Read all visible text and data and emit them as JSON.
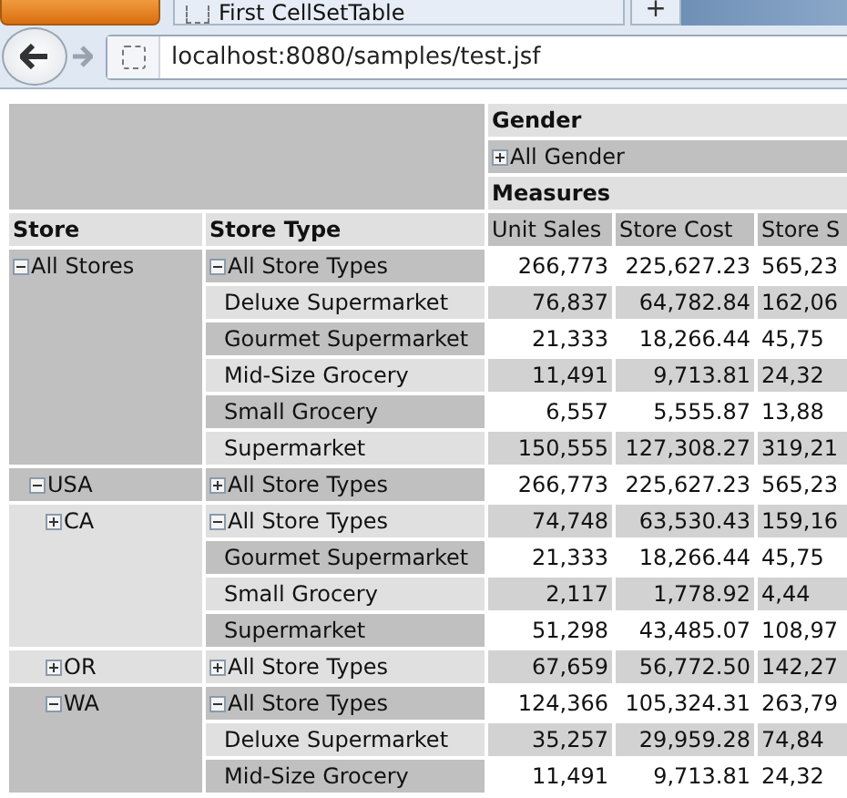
{
  "browser": {
    "tab_title": "First CellSetTable",
    "new_tab": "+",
    "url": "localhost:8080/samples/test.jsf"
  },
  "pivot": {
    "column_hierarchy": "Gender",
    "column_member": {
      "name": "All Gender",
      "expanded": false
    },
    "measures_label": "Measures",
    "row_headers": [
      "Store",
      "Store Type"
    ],
    "measures": [
      "Unit Sales",
      "Store Cost",
      "Store S"
    ],
    "stores": [
      {
        "name": "All Stores",
        "expanded": true,
        "types": [
          {
            "kind": "all",
            "name": "All Store Types",
            "expanded": true,
            "values": [
              "266,773",
              "225,627.23",
              "565,23"
            ]
          },
          {
            "kind": "leaf",
            "name": "Deluxe Supermarket",
            "values": [
              "76,837",
              "64,782.84",
              "162,06"
            ]
          },
          {
            "kind": "leaf",
            "name": "Gourmet Supermarket",
            "values": [
              "21,333",
              "18,266.44",
              "45,75"
            ]
          },
          {
            "kind": "leaf",
            "name": "Mid-Size Grocery",
            "values": [
              "11,491",
              "9,713.81",
              "24,32"
            ]
          },
          {
            "kind": "leaf",
            "name": "Small Grocery",
            "values": [
              "6,557",
              "5,555.87",
              "13,88"
            ]
          },
          {
            "kind": "leaf",
            "name": "Supermarket",
            "values": [
              "150,555",
              "127,308.27",
              "319,21"
            ]
          }
        ],
        "children": [
          {
            "name": "USA",
            "expanded": true,
            "types": [
              {
                "kind": "all",
                "name": "All Store Types",
                "expanded": false,
                "values": [
                  "266,773",
                  "225,627.23",
                  "565,23"
                ]
              }
            ],
            "children": [
              {
                "name": "CA",
                "expanded": false,
                "types": [
                  {
                    "kind": "all",
                    "name": "All Store Types",
                    "expanded": true,
                    "values": [
                      "74,748",
                      "63,530.43",
                      "159,16"
                    ]
                  },
                  {
                    "kind": "leaf",
                    "name": "Gourmet Supermarket",
                    "values": [
                      "21,333",
                      "18,266.44",
                      "45,75"
                    ]
                  },
                  {
                    "kind": "leaf",
                    "name": "Small Grocery",
                    "values": [
                      "2,117",
                      "1,778.92",
                      "4,44"
                    ]
                  },
                  {
                    "kind": "leaf",
                    "name": "Supermarket",
                    "values": [
                      "51,298",
                      "43,485.07",
                      "108,97"
                    ]
                  }
                ]
              },
              {
                "name": "OR",
                "expanded": false,
                "types": [
                  {
                    "kind": "all",
                    "name": "All Store Types",
                    "expanded": false,
                    "values": [
                      "67,659",
                      "56,772.50",
                      "142,27"
                    ]
                  }
                ]
              },
              {
                "name": "WA",
                "expanded": true,
                "types": [
                  {
                    "kind": "all",
                    "name": "All Store Types",
                    "expanded": true,
                    "values": [
                      "124,366",
                      "105,324.31",
                      "263,79"
                    ]
                  },
                  {
                    "kind": "leaf",
                    "name": "Deluxe Supermarket",
                    "values": [
                      "35,257",
                      "29,959.28",
                      "74,84"
                    ]
                  },
                  {
                    "kind": "leaf",
                    "name": "Mid-Size Grocery",
                    "values": [
                      "11,491",
                      "9,713.81",
                      "24,32"
                    ]
                  }
                ]
              }
            ]
          }
        ]
      }
    ]
  }
}
